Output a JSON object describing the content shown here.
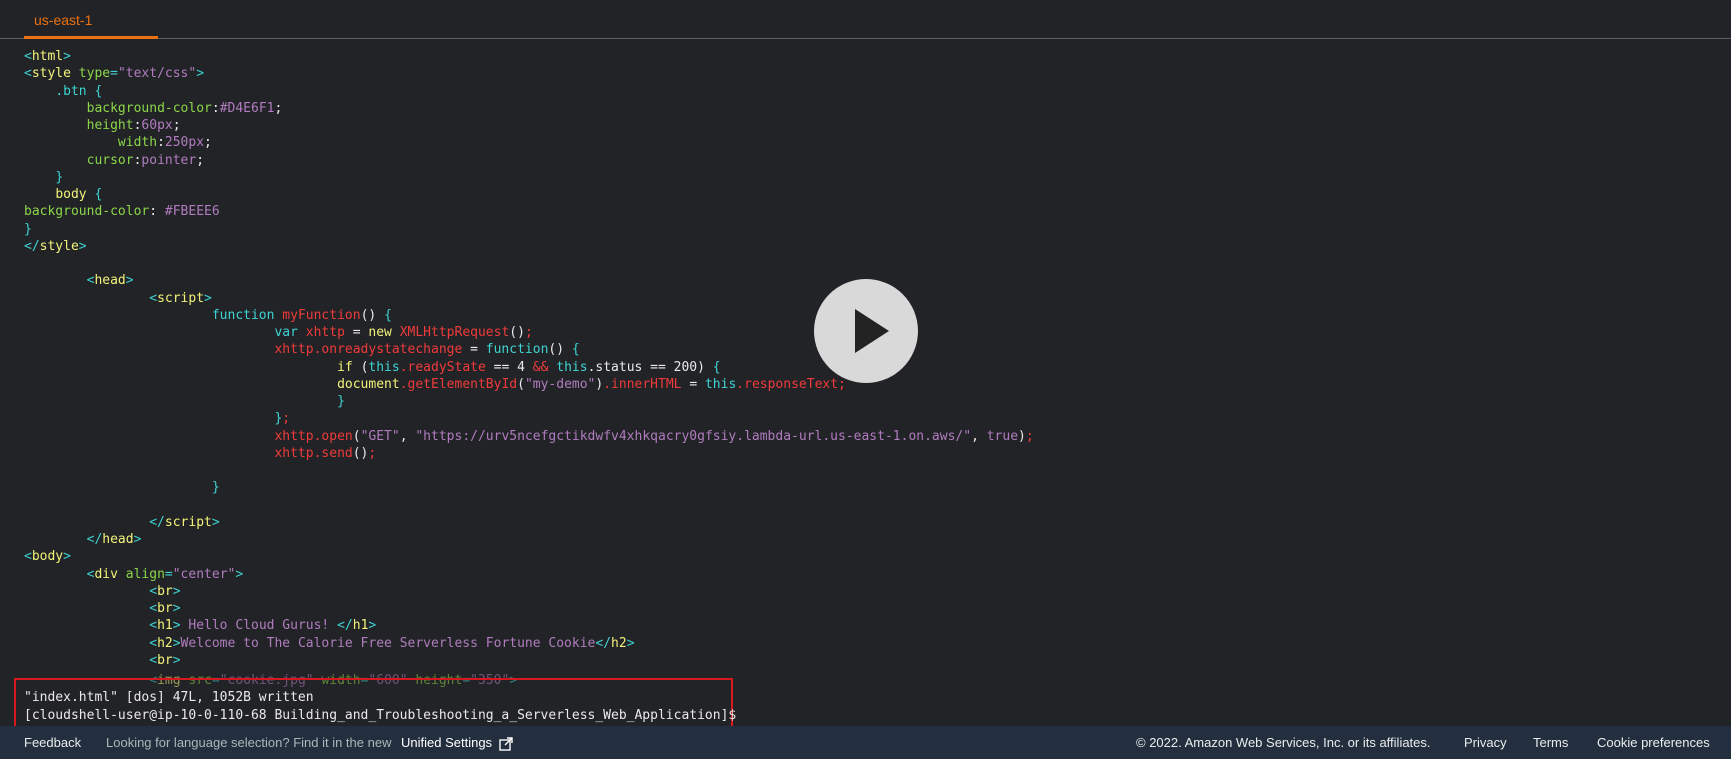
{
  "tab": {
    "label": "us-east-1"
  },
  "code_lines": [
    [
      [
        "c",
        "<"
      ],
      [
        "y",
        "html"
      ],
      [
        "c",
        ">"
      ]
    ],
    [
      [
        "c",
        "<"
      ],
      [
        "y",
        "style "
      ],
      [
        "g",
        "type"
      ],
      [
        "c",
        "="
      ],
      [
        "m",
        "\"text/css\""
      ],
      [
        "c",
        ">"
      ]
    ],
    [
      [
        "w",
        "    "
      ],
      [
        "c",
        ".btn {"
      ]
    ],
    [
      [
        "w",
        "        "
      ],
      [
        "g",
        "background-color"
      ],
      [
        "w",
        ":"
      ],
      [
        "m",
        "#D4E6F1"
      ],
      [
        "w",
        ";"
      ]
    ],
    [
      [
        "w",
        "        "
      ],
      [
        "g",
        "height"
      ],
      [
        "w",
        ":"
      ],
      [
        "m",
        "60px"
      ],
      [
        "w",
        ";"
      ]
    ],
    [
      [
        "w",
        "            "
      ],
      [
        "g",
        "width"
      ],
      [
        "w",
        ":"
      ],
      [
        "m",
        "250px"
      ],
      [
        "w",
        ";"
      ]
    ],
    [
      [
        "w",
        "        "
      ],
      [
        "g",
        "cursor"
      ],
      [
        "w",
        ":"
      ],
      [
        "m",
        "pointer"
      ],
      [
        "w",
        ";"
      ]
    ],
    [
      [
        "w",
        "    "
      ],
      [
        "c",
        "}"
      ]
    ],
    [
      [
        "w",
        "    "
      ],
      [
        "y",
        "body "
      ],
      [
        "c",
        "{"
      ]
    ],
    [
      [
        "g",
        "background-color"
      ],
      [
        "w",
        ": "
      ],
      [
        "m",
        "#FBEEE6"
      ]
    ],
    [
      [
        "c",
        "}"
      ]
    ],
    [
      [
        "c",
        "</"
      ],
      [
        "y",
        "style"
      ],
      [
        "c",
        ">"
      ]
    ],
    [
      [
        "w",
        ""
      ]
    ],
    [
      [
        "w",
        "        "
      ],
      [
        "c",
        "<"
      ],
      [
        "y",
        "head"
      ],
      [
        "c",
        ">"
      ]
    ],
    [
      [
        "w",
        "                "
      ],
      [
        "c",
        "<"
      ],
      [
        "y",
        "script"
      ],
      [
        "c",
        ">"
      ]
    ],
    [
      [
        "w",
        "                        "
      ],
      [
        "c",
        "function "
      ],
      [
        "r",
        "myFunction"
      ],
      [
        "w",
        "() "
      ],
      [
        "c",
        "{"
      ]
    ],
    [
      [
        "w",
        "                                "
      ],
      [
        "c",
        "var "
      ],
      [
        "r",
        "xhttp"
      ],
      [
        "w",
        " = "
      ],
      [
        "y",
        "new "
      ],
      [
        "r",
        "XMLHttpRequest"
      ],
      [
        "w",
        "()"
      ],
      [
        "r",
        ";"
      ]
    ],
    [
      [
        "w",
        "                                "
      ],
      [
        "r",
        "xhttp.onreadystatechange"
      ],
      [
        "w",
        " = "
      ],
      [
        "c",
        "function"
      ],
      [
        "w",
        "() "
      ],
      [
        "c",
        "{"
      ]
    ],
    [
      [
        "w",
        "                                        "
      ],
      [
        "y",
        "if "
      ],
      [
        "w",
        "("
      ],
      [
        "c",
        "this"
      ],
      [
        "r",
        ".readyState"
      ],
      [
        "w",
        " == 4 "
      ],
      [
        "r",
        "&&"
      ],
      [
        "c",
        " this"
      ],
      [
        "w",
        ".status == 200) "
      ],
      [
        "c",
        "{"
      ]
    ],
    [
      [
        "w",
        "                                        "
      ],
      [
        "y",
        "document"
      ],
      [
        "r",
        ".getElementById"
      ],
      [
        "w",
        "("
      ],
      [
        "m",
        "\"my-demo\""
      ],
      [
        "w",
        ")"
      ],
      [
        "r",
        ".innerHTML"
      ],
      [
        "w",
        " = "
      ],
      [
        "c",
        "this"
      ],
      [
        "r",
        ".responseText;"
      ]
    ],
    [
      [
        "w",
        "                                        "
      ],
      [
        "c",
        "}"
      ]
    ],
    [
      [
        "w",
        "                                "
      ],
      [
        "c",
        "}"
      ],
      [
        "r",
        ";"
      ]
    ],
    [
      [
        "w",
        "                                "
      ],
      [
        "r",
        "xhttp.open"
      ],
      [
        "w",
        "("
      ],
      [
        "m",
        "\"GET\""
      ],
      [
        "w",
        ", "
      ],
      [
        "m",
        "\"https://urv5ncefgctikdwfv4xhkqacry0gfsiy.lambda-url.us-east-1.on.aws/\""
      ],
      [
        "w",
        ", "
      ],
      [
        "m",
        "true"
      ],
      [
        "w",
        ")"
      ],
      [
        "r",
        ";"
      ]
    ],
    [
      [
        "w",
        "                                "
      ],
      [
        "r",
        "xhttp.send"
      ],
      [
        "w",
        "()"
      ],
      [
        "r",
        ";"
      ]
    ],
    [
      [
        "w",
        ""
      ]
    ],
    [
      [
        "w",
        "                        "
      ],
      [
        "c",
        "}"
      ]
    ],
    [
      [
        "w",
        ""
      ]
    ],
    [
      [
        "w",
        "                "
      ],
      [
        "c",
        "</"
      ],
      [
        "y",
        "script"
      ],
      [
        "c",
        ">"
      ]
    ],
    [
      [
        "w",
        "        "
      ],
      [
        "c",
        "</"
      ],
      [
        "y",
        "head"
      ],
      [
        "c",
        ">"
      ]
    ],
    [
      [
        "c",
        "<"
      ],
      [
        "y",
        "body"
      ],
      [
        "c",
        ">"
      ]
    ],
    [
      [
        "w",
        "        "
      ],
      [
        "c",
        "<"
      ],
      [
        "y",
        "div "
      ],
      [
        "g",
        "align"
      ],
      [
        "c",
        "="
      ],
      [
        "m",
        "\"center\""
      ],
      [
        "c",
        ">"
      ]
    ],
    [
      [
        "w",
        "                "
      ],
      [
        "c",
        "<"
      ],
      [
        "y",
        "br"
      ],
      [
        "c",
        ">"
      ]
    ],
    [
      [
        "w",
        "                "
      ],
      [
        "c",
        "<"
      ],
      [
        "y",
        "br"
      ],
      [
        "c",
        ">"
      ]
    ],
    [
      [
        "w",
        "                "
      ],
      [
        "c",
        "<"
      ],
      [
        "y",
        "h1"
      ],
      [
        "c",
        ">"
      ],
      [
        "m",
        " Hello Cloud Gurus! "
      ],
      [
        "c",
        "</"
      ],
      [
        "y",
        "h1"
      ],
      [
        "c",
        ">"
      ]
    ],
    [
      [
        "w",
        "                "
      ],
      [
        "c",
        "<"
      ],
      [
        "y",
        "h2"
      ],
      [
        "c",
        ">"
      ],
      [
        "m",
        "Welcome to The Calorie Free Serverless Fortune Cookie"
      ],
      [
        "c",
        "</"
      ],
      [
        "y",
        "h2"
      ],
      [
        "c",
        ">"
      ]
    ],
    [
      [
        "w",
        "                "
      ],
      [
        "c",
        "<"
      ],
      [
        "y",
        "br"
      ],
      [
        "c",
        ">"
      ]
    ]
  ],
  "faded_line": [
    [
      "w",
      "                "
    ],
    [
      "c",
      "<"
    ],
    [
      "y",
      "img "
    ],
    [
      "g",
      "src"
    ],
    [
      "c",
      "="
    ],
    [
      "m",
      "\"cookie.jpg\" "
    ],
    [
      "g",
      "width"
    ],
    [
      "c",
      "="
    ],
    [
      "m",
      "\"600\" "
    ],
    [
      "g",
      "height"
    ],
    [
      "c",
      "="
    ],
    [
      "m",
      "\"350\""
    ],
    [
      "c",
      ">"
    ]
  ],
  "status": {
    "line1": "\"index.html\" [dos] 47L, 1052B written",
    "line2": "[cloudshell-user@ip-10-0-110-68 Building_and_Troubleshooting_a_Serverless_Web_Application]$"
  },
  "footer": {
    "feedback": "Feedback",
    "language_prompt": "Looking for language selection? Find it in the new",
    "unified_settings": "Unified Settings",
    "copyright": "© 2022. Amazon Web Services, Inc. or its affiliates.",
    "privacy": "Privacy",
    "terms": "Terms",
    "cookie_preferences": "Cookie preferences"
  },
  "colors": {
    "accent": "#ec7211",
    "highlight_box": "#d5191f",
    "footer_bg": "#232f3e"
  },
  "icons": {
    "play": "play-icon",
    "external_link": "external-link-icon"
  }
}
